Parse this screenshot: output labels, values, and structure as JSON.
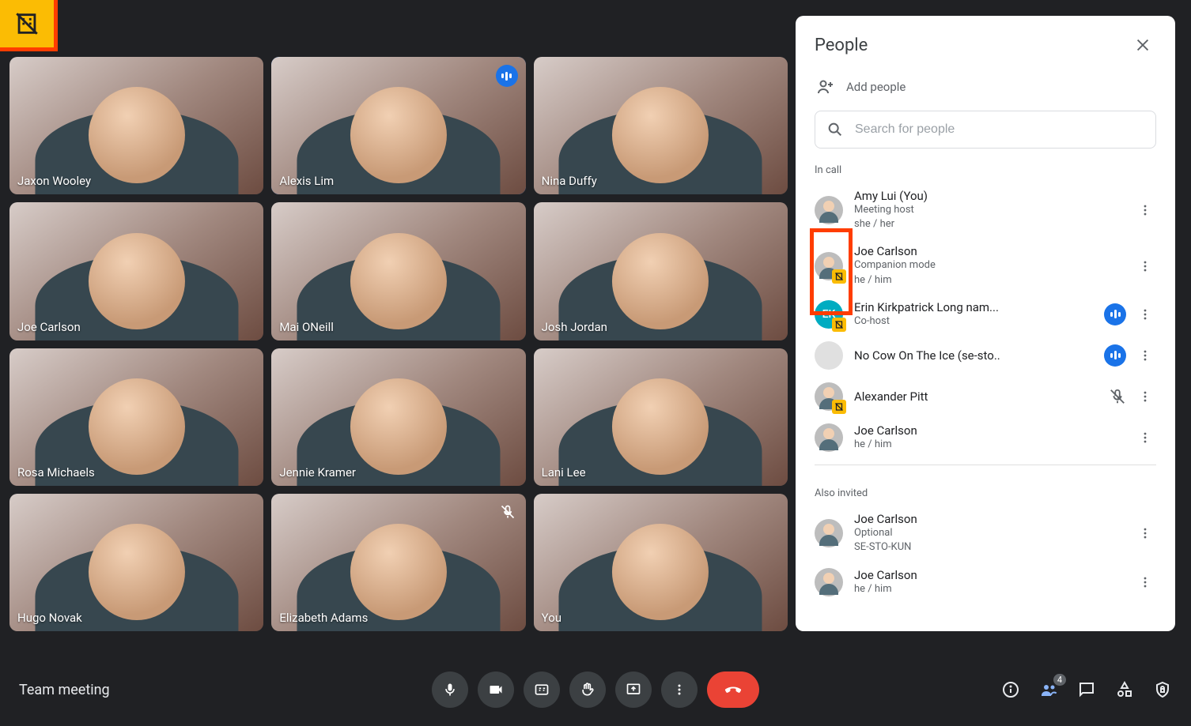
{
  "meeting": {
    "title": "Team meeting"
  },
  "topLeftBadge": "building-off",
  "tiles": [
    {
      "name": "Jaxon Wooley",
      "speaking": false,
      "muted": false
    },
    {
      "name": "Alexis Lim",
      "speaking": true,
      "muted": false
    },
    {
      "name": "Nina Duffy",
      "speaking": false,
      "muted": false
    },
    {
      "name": "Joe Carlson",
      "speaking": false,
      "muted": false
    },
    {
      "name": "Mai ONeill",
      "speaking": false,
      "muted": false
    },
    {
      "name": "Josh Jordan",
      "speaking": false,
      "muted": false
    },
    {
      "name": "Rosa Michaels",
      "speaking": false,
      "muted": false
    },
    {
      "name": "Jennie Kramer",
      "speaking": false,
      "muted": false
    },
    {
      "name": "Lani Lee",
      "speaking": false,
      "muted": false
    },
    {
      "name": "Hugo Novak",
      "speaking": false,
      "muted": false
    },
    {
      "name": "Elizabeth Adams",
      "speaking": false,
      "muted": true
    },
    {
      "name": "You",
      "speaking": false,
      "muted": false
    }
  ],
  "panel": {
    "title": "People",
    "addLabel": "Add people",
    "searchPlaceholder": "Search for people",
    "inCallLabel": "In call",
    "alsoInvitedLabel": "Also invited",
    "inCall": [
      {
        "name": "Amy Lui (You)",
        "sub": "Meeting host",
        "sub2": "she / her",
        "avatar": "photo"
      },
      {
        "name": "Joe Carlson",
        "sub": "Companion mode",
        "sub2": "he / him",
        "avatar": "photo",
        "buildingBadge": true
      },
      {
        "name": "Erin Kirkpatrick Long nam...",
        "sub": "Co-host",
        "avatar": "initials",
        "initials": "EK",
        "buildingBadge": true,
        "speaking": true
      },
      {
        "name": "No Cow On The Ice (se-sto..",
        "avatar": "blank",
        "speaking": true
      },
      {
        "name": "Alexander Pitt",
        "avatar": "photo",
        "buildingBadge": true,
        "micOff": true
      },
      {
        "name": "Joe Carlson",
        "sub": "he / him",
        "avatar": "photo"
      }
    ],
    "alsoInvited": [
      {
        "name": "Joe Carlson",
        "sub": "Optional",
        "sub2": "SE-STO-KUN",
        "avatar": "photo"
      },
      {
        "name": "Joe Carlson",
        "sub": "he / him",
        "avatar": "photo"
      }
    ]
  },
  "bottom": {
    "peopleCount": "4"
  }
}
